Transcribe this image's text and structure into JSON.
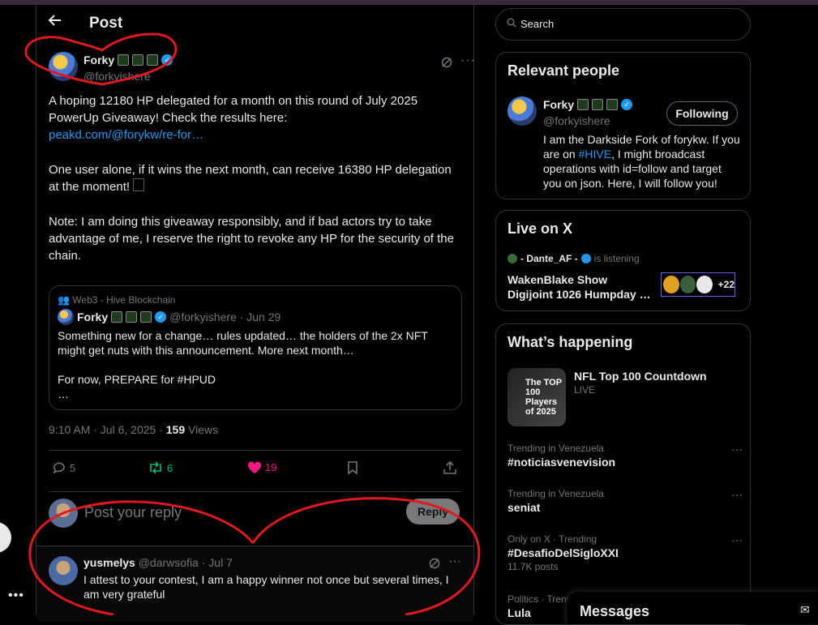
{
  "header": {
    "title": "Post"
  },
  "post": {
    "author_name": "Forky",
    "author_handle": "@forkyishere",
    "para1_text": "A hoping 12180 HP delegated for a month on this round of July 2025 PowerUp Giveaway! Check the results here:",
    "para1_link": "peakd.com/@forykw/re-for…",
    "para2": "One user alone, if it wins the next month, can receive 16380 HP delegation at the moment!",
    "para3": "Note: I am doing this giveaway responsibly, and if bad actors try to take advantage of me, I reserve the right to revoke any HP for the security of the chain.",
    "timestamp": "9:10 AM · Jul 6, 2025 ·",
    "views_count": "159",
    "views_label": "Views",
    "replies": "5",
    "reposts": "6",
    "likes": "19"
  },
  "quote": {
    "community": "Web3 - Hive Blockchain",
    "author_name": "Forky",
    "author_meta": "@forkyishere · Jun 29",
    "line1": "Something new for a change… rules updated… the holders of the 2x NFT might get nuts with this announcement. More next month…",
    "line2": "For now, PREPARE for #HPUD",
    "line3": "…"
  },
  "reply_box": {
    "placeholder": "Post your reply",
    "button": "Reply"
  },
  "comment": {
    "author_name": "yusmelys",
    "author_meta": "@darwsofia · Jul 7",
    "text": "I attest to your contest, I am a happy winner not once but several times, I am very grateful"
  },
  "search": {
    "placeholder": "Search"
  },
  "relevant_people": {
    "title": "Relevant people",
    "name": "Forky",
    "handle": "@forkyishere",
    "button": "Following",
    "bio_1": "I am the Darkside Fork of forykw. If you are on ",
    "bio_hashtag": "#HIVE",
    "bio_2": ", I might broadcast operations with id=follow and target you on json. Here, I will follow you!"
  },
  "live": {
    "title": "Live on X",
    "user": "- Dante_AF -",
    "status": "is listening",
    "show_title": "WakenBlake Show Digijoint 1026 Humpday …",
    "count": "+22"
  },
  "whats_happening": {
    "title": "What’s happening",
    "first_title": "NFL Top 100 Countdown",
    "first_sub": "LIVE",
    "image_text": "The TOP 100 Players of 2025",
    "trends": [
      {
        "category": "Trending in Venezuela",
        "name": "#noticiasvenevision",
        "count": ""
      },
      {
        "category": "Trending in Venezuela",
        "name": "seniat",
        "count": ""
      },
      {
        "category": "Only on X · Trending",
        "name": "#DesafioDelSigloXXI",
        "count": "11.7K posts"
      },
      {
        "category": "Politics · Trending",
        "name": "Lula",
        "count": ""
      }
    ]
  },
  "messages": {
    "title": "Messages"
  },
  "colors": {
    "accent": "#1d9bf0",
    "like": "#f91880",
    "repost": "#00ba7c",
    "annotation": "#e0181f"
  }
}
